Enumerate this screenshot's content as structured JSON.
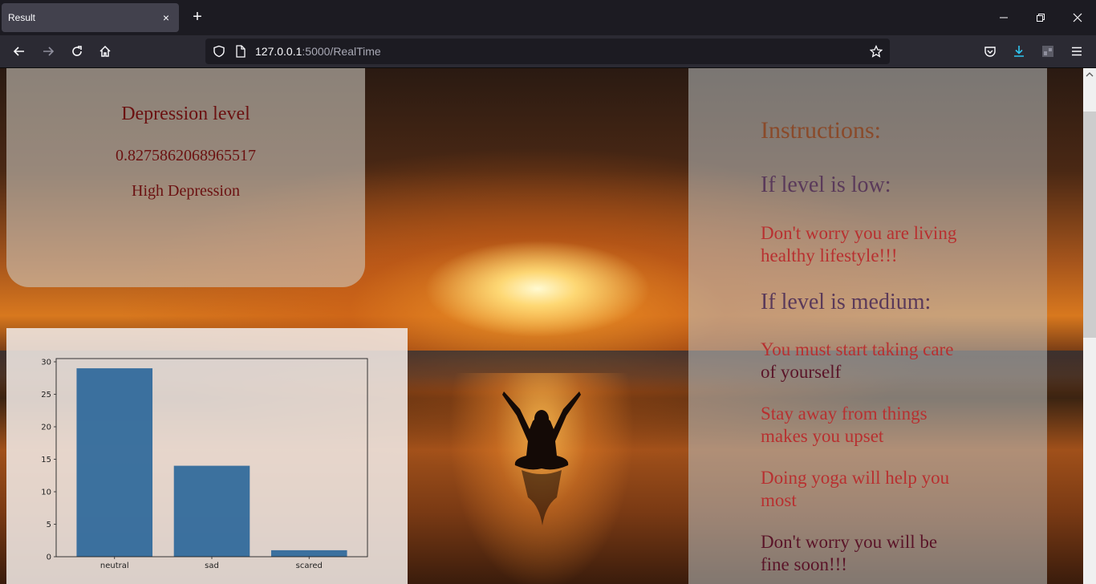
{
  "browser": {
    "tab_title": "Result",
    "tab_close": "×",
    "new_tab": "+",
    "url_host": "127.0.0.1",
    "url_rest": ":5000/RealTime"
  },
  "depression": {
    "title": "Depression level",
    "value": "0.8275862068965517",
    "status": "High Depression"
  },
  "instructions": {
    "heading": "Instructions:",
    "low_heading": "If level is low:",
    "low_line1": "Don't worry you are living",
    "low_line2": "healthy lifestyle!!!",
    "medium_heading": "If level is medium:",
    "medium_line1": "You must start taking care",
    "medium_line2": "of yourself",
    "tip1_line1": "Stay away from things",
    "tip1_line2": "makes you upset",
    "tip2_line1": "Doing yoga will help you",
    "tip2_line2": "most",
    "closing_line1": "Don't worry you will be",
    "closing_line2": "fine soon!!!"
  },
  "chart_data": {
    "type": "bar",
    "categories": [
      "neutral",
      "sad",
      "scared"
    ],
    "values": [
      29,
      14,
      1
    ],
    "ylim": [
      0,
      30
    ],
    "yticks": [
      0,
      5,
      10,
      15,
      20,
      25,
      30
    ],
    "bar_color": "#1f5f96",
    "title": "",
    "xlabel": "",
    "ylabel": ""
  }
}
